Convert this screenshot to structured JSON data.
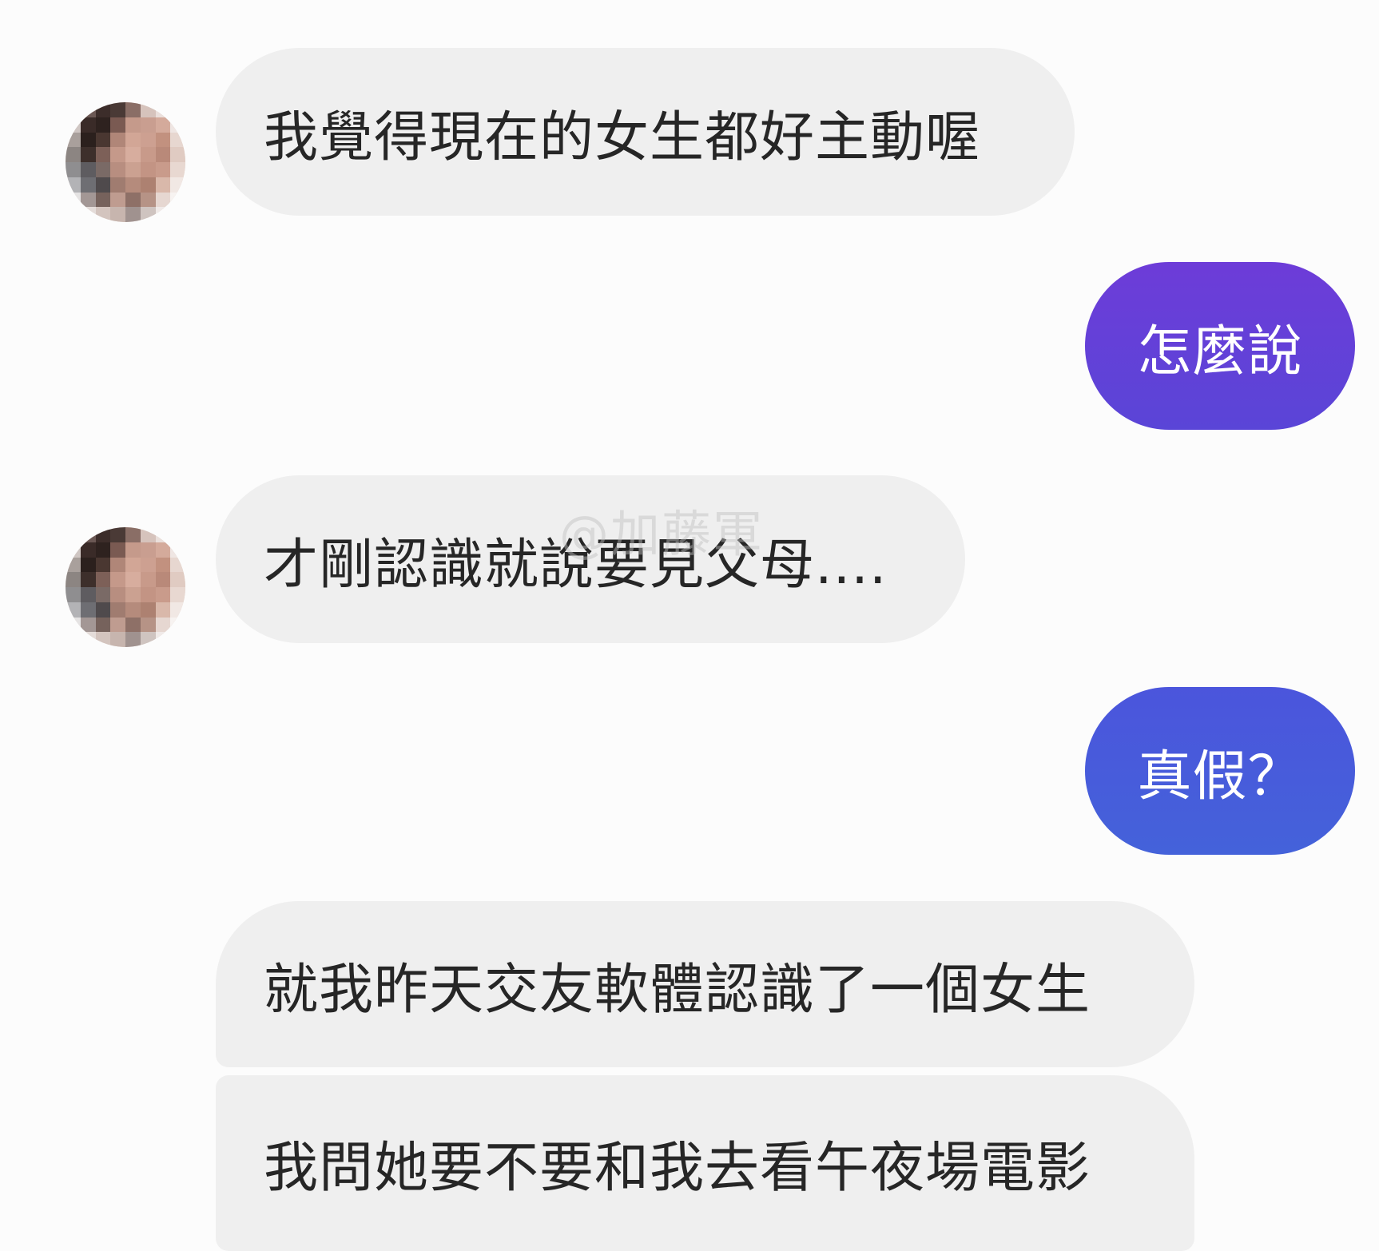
{
  "conversation": {
    "messages": [
      {
        "sender": "other",
        "text": "我覺得現在的女生都好主動喔"
      },
      {
        "sender": "me",
        "text": "怎麼說"
      },
      {
        "sender": "other",
        "text": "才剛認識就說要見父母...."
      },
      {
        "sender": "me",
        "text": "真假？"
      },
      {
        "sender": "other",
        "text": "就我昨天交友軟體認識了一個女生"
      },
      {
        "sender": "other",
        "text": "我問她要不要和我去看午夜場電影"
      }
    ]
  },
  "watermark": "@加藤軍",
  "colors": {
    "incoming_bubble": "#efefef",
    "incoming_text": "#262626",
    "outgoing_bubble_purple": "#6a3fd6",
    "outgoing_bubble_blue": "#4659da",
    "background": "#fcfcfc"
  }
}
